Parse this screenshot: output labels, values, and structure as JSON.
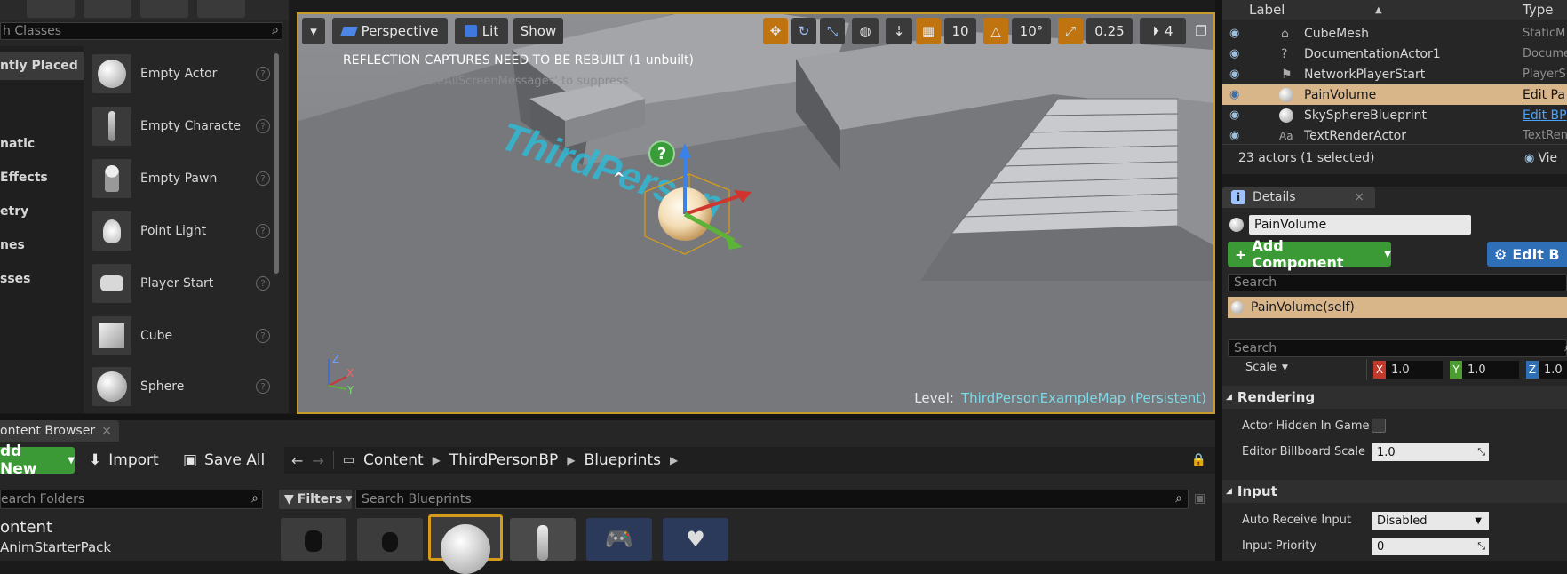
{
  "place_panel": {
    "search_placeholder": "h Classes",
    "categories": [
      {
        "label": "ntly Placed",
        "active": true
      },
      {
        "label": "",
        "active": false
      },
      {
        "label": "",
        "active": false
      },
      {
        "label": "natic",
        "active": false
      },
      {
        "label": " Effects",
        "active": false
      },
      {
        "label": "etry",
        "active": false
      },
      {
        "label": "nes",
        "active": false
      },
      {
        "label": "sses",
        "active": false
      }
    ],
    "items": [
      {
        "label": "Empty Actor",
        "icon": "sphere-icon"
      },
      {
        "label": "Empty Characte",
        "icon": "mannequin-icon"
      },
      {
        "label": "Empty Pawn",
        "icon": "pawn-icon"
      },
      {
        "label": "Point Light",
        "icon": "lightbulb-icon"
      },
      {
        "label": "Player Start",
        "icon": "player-start-icon"
      },
      {
        "label": "Cube",
        "icon": "cube-icon"
      },
      {
        "label": "Sphere",
        "icon": "sphere-icon"
      }
    ],
    "help_glyph": "?"
  },
  "viewport": {
    "menu_glyph": "▾",
    "perspective_label": "Perspective",
    "lit_label": "Lit",
    "show_label": "Show",
    "grid_value": "10",
    "rotation_value": "10°",
    "scale_value": "0.25",
    "camera_speed": "4",
    "message": "REFLECTION CAPTURES NEED TO BE REBUILT (1 unbuilt)",
    "message_ghost": "'DisableAllScreenMessages' to suppress",
    "level_prefix": "Level:",
    "level_name": "ThirdPersonExampleMap (Persistent)",
    "floor_text": "ThirdPerson",
    "axis_labels": {
      "z": "Z",
      "x": "X",
      "y": "Y"
    }
  },
  "outliner": {
    "col_label": "Label",
    "col_type": "Type",
    "rows": [
      {
        "label": "CubeMesh",
        "type": "StaticM",
        "selected": false,
        "link": false
      },
      {
        "label": "DocumentationActor1",
        "type": "Docume",
        "selected": false,
        "link": false
      },
      {
        "label": "NetworkPlayerStart",
        "type": "PlayerS",
        "selected": false,
        "link": false
      },
      {
        "label": "PainVolume",
        "type": "Edit Pa",
        "selected": true,
        "link": true
      },
      {
        "label": "SkySphereBlueprint",
        "type": "Edit BP",
        "selected": false,
        "link": true
      },
      {
        "label": "TextRenderActor",
        "type": "TextRen",
        "selected": false,
        "link": false
      }
    ],
    "status": "23 actors (1 selected)",
    "view_options": "Vie"
  },
  "details": {
    "tab_label": "Details",
    "tab_close": "×",
    "name_value": "PainVolume",
    "add_component": "Add Component",
    "edit_blueprint": "Edit B",
    "search_placeholder": "Search",
    "component_self": "PainVolume(self)",
    "search2_placeholder": "Search",
    "scale_label": "Scale",
    "scale_x": "1.0",
    "scale_y": "1.0",
    "scale_z": "1.0",
    "x_tag": "X",
    "y_tag": "Y",
    "z_tag": "Z",
    "rendering_header": "Rendering",
    "actor_hidden_label": "Actor Hidden In Game",
    "billboard_label": "Editor Billboard Scale",
    "billboard_value": "1.0",
    "input_header": "Input",
    "auto_receive_label": "Auto Receive Input",
    "auto_receive_value": "Disabled",
    "input_priority_label": "Input Priority",
    "input_priority_value": "0"
  },
  "content_browser": {
    "tab_label": "ontent Browser",
    "tab_close": "×",
    "add_new": "dd New",
    "import_label": "Import",
    "save_all": "Save All",
    "path": [
      "Content",
      "ThirdPersonBP",
      "Blueprints"
    ],
    "folder_search_placeholder": "earch Folders",
    "filters_label": "Filters",
    "asset_search_placeholder": "Search Blueprints",
    "tree_root": "ontent",
    "tree_child": "AnimStarterPack"
  },
  "colors": {
    "accent_orange": "#c07410",
    "selected_row": "#d9b58a",
    "add_green": "#3c9a36",
    "edit_blue": "#2f6fb7",
    "link_blue": "#4aa3ff",
    "level_cyan": "#7fd8e6"
  }
}
